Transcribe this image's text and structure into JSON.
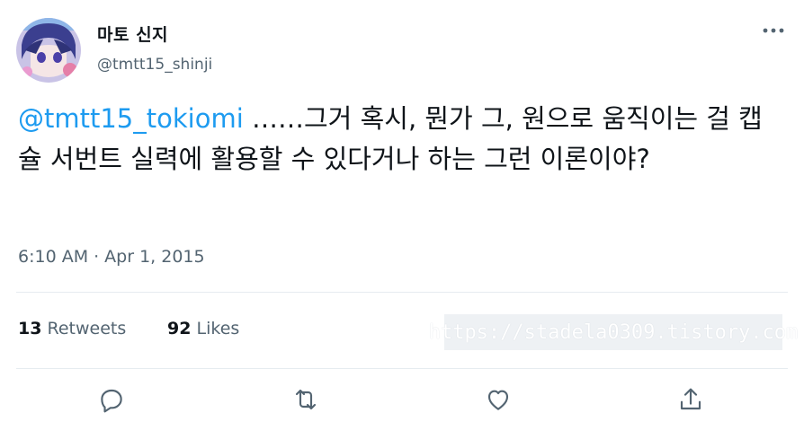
{
  "user": {
    "display_name": "마토 신지",
    "handle": "@tmtt15_shinji"
  },
  "tweet": {
    "mention": "@tmtt15_tokiomi",
    "text": " ……그거 혹시, 뭔가 그, 원으로 움직이는 걸 캡슐 서번트 실력에 활용할 수 있다거나 하는 그런 이론이야?",
    "time": "6:10 AM",
    "date": "Apr 1, 2015"
  },
  "stats": {
    "retweets_count": "13",
    "retweets_label": "Retweets",
    "likes_count": "92",
    "likes_label": "Likes"
  },
  "watermark": "https://stadela0309.tistory.com",
  "icons": {
    "more": "more-icon",
    "reply": "reply-icon",
    "retweet": "retweet-icon",
    "like": "like-icon",
    "share": "share-icon"
  },
  "colors": {
    "link": "#1d9bf0",
    "secondary": "#536471",
    "text": "#0f1419"
  }
}
